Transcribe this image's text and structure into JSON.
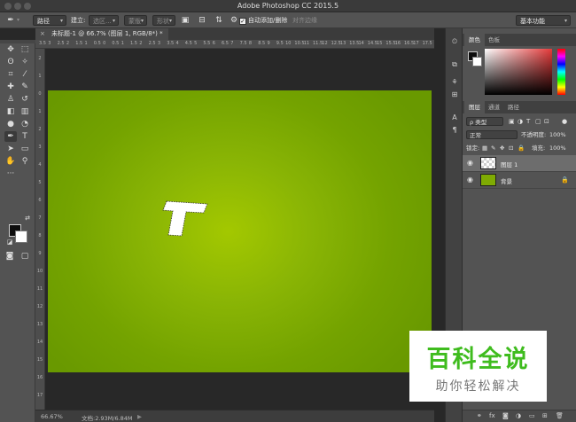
{
  "window": {
    "title": "Adobe Photoshop CC 2015.5"
  },
  "options": {
    "mode_value": "路径",
    "make_label": "建立:",
    "selection_button": "选区...",
    "mask_button": "蒙版",
    "shape_button": "形状",
    "auto_add_delete_label": "自动添加/删除",
    "auto_add_delete_checked": "✓",
    "align_edges_label": "对齐边缘",
    "workspace_value": "基本功能"
  },
  "document": {
    "tab_title": "未标题-1 @ 66.7% (图层 1, RGB/8*) *",
    "close_symbol": "×",
    "ruler_h_marks": [
      "3.5",
      "3",
      "2.5",
      "2",
      "1.5",
      "1",
      "0.5",
      "0",
      "0.5",
      "1",
      "1.5",
      "2",
      "2.5",
      "3",
      "3.5",
      "4",
      "4.5",
      "5",
      "5.5",
      "6",
      "6.5",
      "7",
      "7.5",
      "8",
      "8.5",
      "9",
      "9.5",
      "10",
      "10.5",
      "11",
      "11.5",
      "12",
      "12.5",
      "13",
      "13.5",
      "14",
      "14.5",
      "15",
      "15.5",
      "16",
      "16.5",
      "17",
      "17.5"
    ],
    "ruler_v_marks": [
      "2",
      "1",
      "0",
      "1",
      "2",
      "3",
      "4",
      "5",
      "6",
      "7",
      "8",
      "9",
      "10",
      "11",
      "12",
      "13",
      "14",
      "15",
      "16",
      "17"
    ],
    "canvas_color": "#8ab505"
  },
  "status": {
    "zoom": "66.67%",
    "doc_info": "文档:2.93M/6.84M",
    "arrow": "▶"
  },
  "panels": {
    "color_tabs": [
      "颜色",
      "色板"
    ],
    "layer_tabs": [
      "图层",
      "通道",
      "路径"
    ],
    "filter_label": "ρ 类型",
    "blend_mode": "正常",
    "opacity_label": "不透明度:",
    "opacity_value": "100%",
    "lock_label": "锁定:",
    "fill_label": "填充:",
    "fill_value": "100%",
    "layers": [
      {
        "name": "图层 1",
        "selected": true
      },
      {
        "name": "背景",
        "locked": true
      }
    ],
    "footer_icons": [
      "link-icon",
      "fx-icon",
      "mask-icon",
      "adjustment-icon",
      "folder-icon",
      "new-layer-icon",
      "trash-icon"
    ]
  },
  "watermark": {
    "title": "百科全说",
    "subtitle": "助你轻松解决",
    "color": "#3fbc1e"
  }
}
